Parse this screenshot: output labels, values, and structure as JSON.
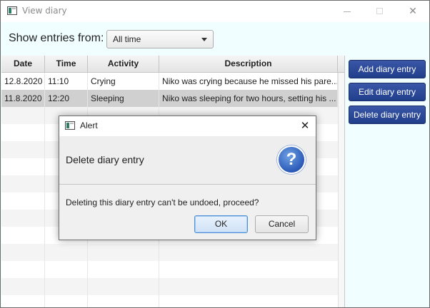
{
  "window": {
    "title": "View diary",
    "minimize_glyph": "",
    "close_glyph": "✕"
  },
  "filter": {
    "label": "Show entries from:",
    "selected": "All time"
  },
  "table": {
    "columns": [
      "Date",
      "Time",
      "Activity",
      "Description"
    ],
    "rows": [
      {
        "date": "12.8.2020",
        "time": "11:10",
        "activity": "Crying",
        "description": "Niko was crying because he missed his pare..."
      },
      {
        "date": "11.8.2020",
        "time": "12:20",
        "activity": "Sleeping",
        "description": "Niko was sleeping for two hours, setting his ..."
      }
    ]
  },
  "actions": {
    "add": "Add diary entry",
    "edit": "Edit diary entry",
    "delete": "Delete diary entry"
  },
  "dialog": {
    "title": "Alert",
    "close_glyph": "✕",
    "heading": "Delete diary entry",
    "icon_glyph": "?",
    "message": "Deleting this diary entry can't be undoed, proceed?",
    "ok": "OK",
    "cancel": "Cancel"
  },
  "colors": {
    "accent_button": "#203f8a",
    "background": "#f0feff",
    "selected_row": "#d0d0d0"
  }
}
